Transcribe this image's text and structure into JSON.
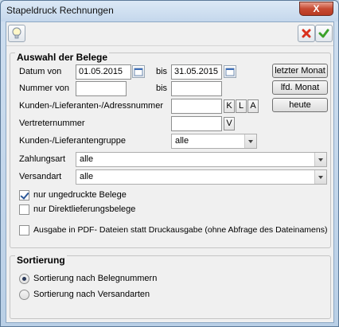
{
  "window": {
    "title": "Stapeldruck Rechnungen",
    "close_label": "X"
  },
  "toolbar": {
    "hint_icon": "lightbulb-icon",
    "cancel_icon": "red-x-icon",
    "ok_icon": "green-check-icon"
  },
  "belege": {
    "title": "Auswahl der Belege",
    "datum_von_label": "Datum von",
    "datum_von_value": "01.05.2015",
    "bis_label_1": "bis",
    "datum_bis_value": "31.05.2015",
    "nummer_von_label": "Nummer von",
    "nummer_von_value": "",
    "bis_label_2": "bis",
    "nummer_bis_value": "",
    "kunden_label": "Kunden-/Lieferanten-/Adressnummer",
    "kunden_value": "",
    "btn_k": "K",
    "btn_l": "L",
    "btn_a": "A",
    "vertreter_label": "Vertreternummer",
    "vertreter_value": "",
    "btn_v": "V",
    "gruppe_label": "Kunden-/Lieferantengruppe",
    "gruppe_value": "alle",
    "zahlungsart_label": "Zahlungsart",
    "zahlungsart_value": "alle",
    "versandart_label": "Versandart",
    "versandart_value": "alle",
    "btn_letzter_monat": "letzter Monat",
    "btn_lfd_monat": "lfd. Monat",
    "btn_heute": "heute",
    "cb_ungedruckt": "nur ungedruckte Belege",
    "cb_direkt": "nur Direktlieferungsbelege",
    "cb_pdf": "Ausgabe in PDF- Dateien statt Druckausgabe (ohne Abfrage des Dateinamens)"
  },
  "sortierung": {
    "title": "Sortierung",
    "opt_belegnummern": "Sortierung nach Belegnummern",
    "opt_versandarten": "Sortierung nach Versandarten"
  }
}
